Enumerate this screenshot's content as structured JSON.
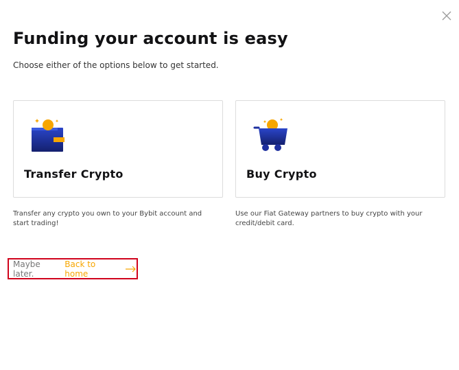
{
  "modal": {
    "title": "Funding your account is easy",
    "subtitle": "Choose either of the options below to get started."
  },
  "options": [
    {
      "label": "Transfer Crypto",
      "icon": "wallet-icon",
      "description": "Transfer any crypto you own to your Bybit account and start trading!"
    },
    {
      "label": "Buy Crypto",
      "icon": "shopping-cart-icon",
      "description": "Use our Fiat Gateway partners to buy crypto with your credit/debit card."
    }
  ],
  "footer": {
    "maybe_later": "Maybe later.",
    "back_link": "Back to home",
    "arrow_icon": "arrow-right-icon"
  },
  "colors": {
    "accent": "#f7a600",
    "icon_blue": "#1e2f9e",
    "highlight_border": "#d0021b"
  }
}
